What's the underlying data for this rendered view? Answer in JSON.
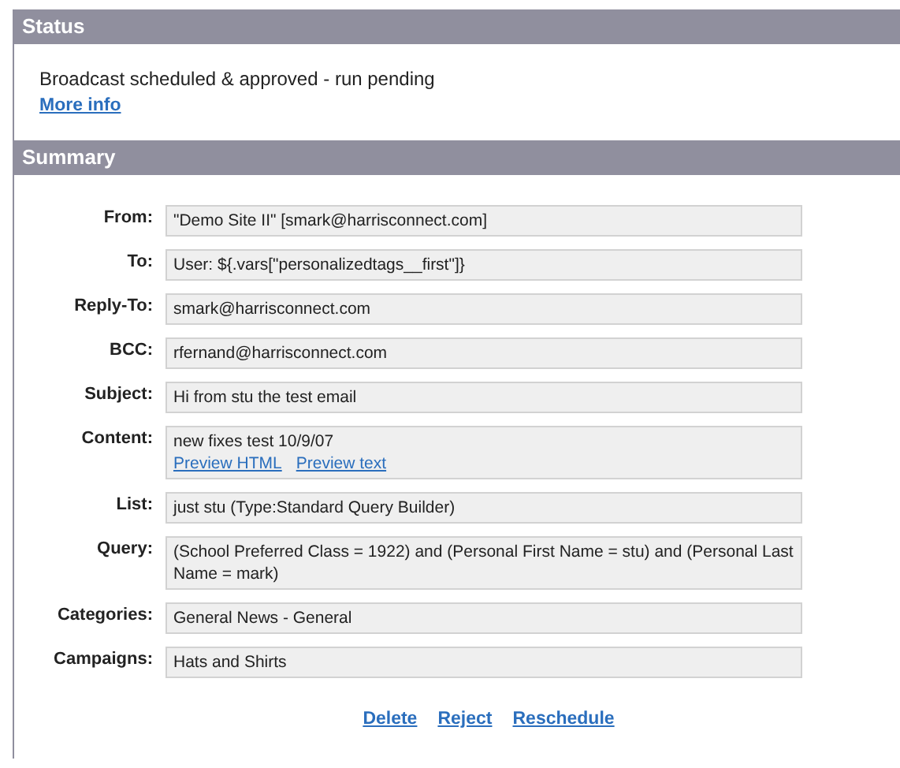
{
  "status": {
    "title": "Status",
    "message": "Broadcast scheduled & approved - run pending",
    "link": "More info"
  },
  "summary": {
    "title": "Summary",
    "fields": [
      {
        "label": "From:",
        "value": "\"Demo Site II\" [smark@harrisconnect.com]"
      },
      {
        "label": "To:",
        "value": "User: ${.vars[\"personalizedtags__first\"]}"
      },
      {
        "label": "Reply-To:",
        "value": "smark@harrisconnect.com"
      },
      {
        "label": "BCC:",
        "value": "rfernand@harrisconnect.com"
      },
      {
        "label": "Subject:",
        "value": "Hi from stu the test email"
      },
      {
        "label": "Content:",
        "value": "new  fixes test 10/9/07",
        "links": [
          "Preview HTML",
          "Preview text"
        ]
      },
      {
        "label": "List:",
        "value": "just stu (Type:Standard Query Builder)"
      },
      {
        "label": "Query:",
        "value": "(School Preferred Class = 1922) and (Personal First Name = stu) and (Personal Last Name = mark)"
      },
      {
        "label": "Categories:",
        "value": "General News - General"
      },
      {
        "label": "Campaigns:",
        "value": "Hats and Shirts"
      }
    ],
    "actions": [
      "Delete",
      "Reject",
      "Reschedule"
    ]
  }
}
